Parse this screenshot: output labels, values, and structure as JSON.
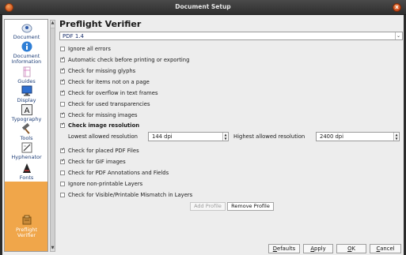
{
  "window": {
    "title": "Document Setup",
    "close_glyph": "x"
  },
  "sidebar": {
    "items": [
      {
        "label": "Document",
        "icon": "document-icon"
      },
      {
        "label": "Document Information",
        "icon": "info-icon"
      },
      {
        "label": "Guides",
        "icon": "guides-icon"
      },
      {
        "label": "Display",
        "icon": "display-icon"
      },
      {
        "label": "Typography",
        "icon": "typography-icon"
      },
      {
        "label": "Tools",
        "icon": "tools-icon"
      },
      {
        "label": "Hyphenator",
        "icon": "hyphenator-icon"
      },
      {
        "label": "Fonts",
        "icon": "fonts-icon"
      },
      {
        "label": "Preflight Verifier",
        "icon": "preflight-icon",
        "active": true
      }
    ],
    "doc_info_line1": "Document",
    "doc_info_line2": "Information",
    "preflight_line1": "Preflight",
    "preflight_line2": "Verifier"
  },
  "main": {
    "title": "Preflight Verifier",
    "profile": {
      "value": "PDF 1.4"
    },
    "options": [
      {
        "label": "Ignore all errors",
        "checked": false
      },
      {
        "label": "Automatic check before printing or exporting",
        "checked": true
      },
      {
        "label": "Check for missing glyphs",
        "checked": true
      },
      {
        "label": "Check for items not on a page",
        "checked": true
      },
      {
        "label": "Check for overflow in text frames",
        "checked": true
      },
      {
        "label": "Check for used transparencies",
        "checked": false
      },
      {
        "label": "Check for missing images",
        "checked": true
      },
      {
        "label": "Check image resolution",
        "checked": true
      }
    ],
    "resolution": {
      "lowest_label": "Lowest allowed resolution",
      "lowest_value": "144 dpi",
      "highest_label": "Highest allowed resolution",
      "highest_value": "2400 dpi"
    },
    "options2": [
      {
        "label": "Check for placed PDF Files",
        "checked": true
      },
      {
        "label": "Check for GIF images",
        "checked": true
      },
      {
        "label": "Check for PDF Annotations and Fields",
        "checked": false
      },
      {
        "label": "Ignore non-printable Layers",
        "checked": false
      },
      {
        "label": "Check for Visible/Printable Mismatch in Layers",
        "checked": false
      }
    ],
    "add_profile": "Add Profile",
    "remove_profile": "Remove Profile"
  },
  "buttons": {
    "defaults_u": "D",
    "defaults_rest": "efaults",
    "apply_u": "A",
    "apply_rest": "pply",
    "ok_u": "O",
    "ok_rest": "K",
    "cancel_u": "C",
    "cancel_rest": "ancel"
  },
  "colors": {
    "active_item": "#f0a64a",
    "sidebar_text": "#1f3f78"
  }
}
